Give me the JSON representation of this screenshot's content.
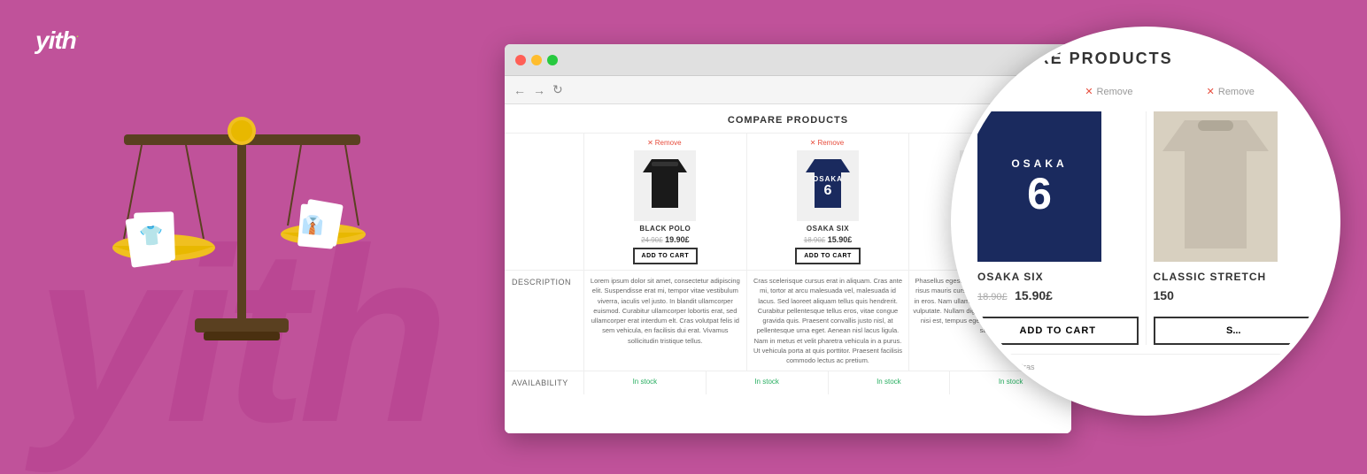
{
  "logo": {
    "text": "yith",
    "dot": "·"
  },
  "watermark": "yith",
  "browser": {
    "title": "Compare Products",
    "compare_header": "COMPARE PRODUCTS",
    "nav": {
      "back": "←",
      "forward": "→",
      "refresh": "↻"
    },
    "products": [
      {
        "name": "BLACK POLO",
        "old_price": "24.90£",
        "new_price": "19.90£",
        "button": "ADD TO CART",
        "button_type": "add",
        "description": "Lorem ipsum dolor sit amet, consectetur adipiscing elit. Suspendisse erat mi, tempor vitae vestibulum viverra, iaculis vel justo. In blandit ullamcorper euismod. Curabitur ullamcorper lobortis erat, sed ullamcorper erat interdum elt. Cras volutpat felis id sem vehicula, en facilisis dui erat. Vivamus sollicitudin tristique tellus.",
        "availability": "In stock"
      },
      {
        "name": "OSAKA SIX",
        "old_price": "18.90£",
        "new_price": "15.90£",
        "button": "ADD TO CART",
        "button_type": "add",
        "description": "Cras scelerisque cursus erat in aliquam. Cras ante mi, tortor at arcu malesuada vel, malesuada id lacus. Sed laoreet aliquam tellus quis hendrerit. Curabitur pellentesque tellus eros, vitae congue gravida quis. Praesent convallis justo nisl, at pellentesque urna eget. Aenean nisl lacus ligula. Nam in metus et velit pharetra vehicula in a purus. Ut vehicula porta at quis porttitor. Praesent facilisis commodo lectus ac pretium.",
        "availability": "In stock"
      },
      {
        "name": "CLASSIC STRETCH",
        "old_price": "",
        "new_price": "150.00£",
        "button": "SET OPTIONS",
        "button_type": "options",
        "description": "Phasellus egestas, nunc non consectetur hendrerit, risus mauris cursus velit, et condimentum nisi enim in eros. Nam ullamcorper neque non elit elementum vulputate. Nullam dignissim lobortis interdum. Donec nisi est, tempus eget dignissim vitae, rutrum vel sapien.",
        "availability": "In stock"
      },
      {
        "name": "",
        "old_price": "",
        "new_price": "",
        "button": "",
        "button_type": "",
        "description": "",
        "availability": "In stock"
      }
    ],
    "labels": {
      "description": "DESCRIPTION",
      "availability": "AVAILABILITY"
    },
    "remove_label": "Remove"
  },
  "magnify": {
    "title": "COMPARE PRODUCTS",
    "remove_label": "Remove",
    "products": [
      {
        "name": "OSAKA SIX",
        "old_price": "18.90£",
        "new_price": "15.90£",
        "button": "ADD TO CART",
        "button_type": "add"
      },
      {
        "name": "CLASSIC STRETCH",
        "old_price": "",
        "new_price": "150",
        "button": "S...",
        "button_type": "options"
      }
    ]
  }
}
